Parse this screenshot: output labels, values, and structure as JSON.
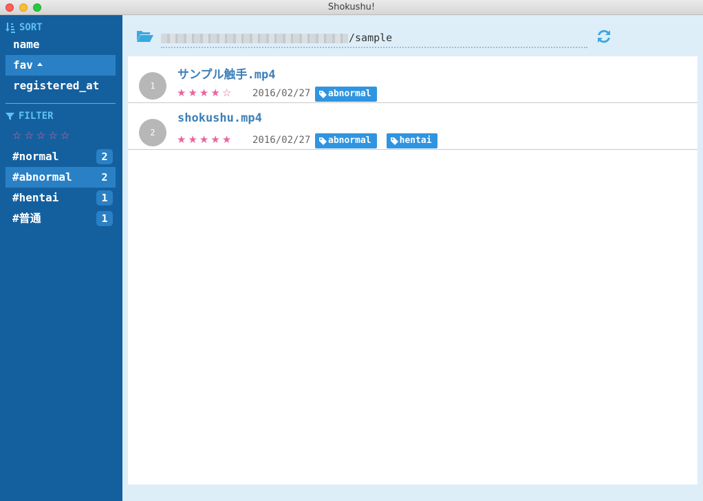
{
  "window": {
    "title": "Shokushu!"
  },
  "sidebar": {
    "sort": {
      "heading": "SORT",
      "icon": "sort-amount-icon",
      "items": [
        {
          "label": "name"
        },
        {
          "label": "fav",
          "active": true
        },
        {
          "label": "registered_at"
        }
      ]
    },
    "filter": {
      "heading": "FILTER",
      "icon": "filter-icon",
      "stars": [
        "☆",
        "☆",
        "☆",
        "☆",
        "☆"
      ],
      "tags": [
        {
          "label": "#normal",
          "count": "2"
        },
        {
          "label": "#abnormal",
          "count": "2",
          "active": true
        },
        {
          "label": "#hentai",
          "count": "1"
        },
        {
          "label": "#普通",
          "count": "1"
        }
      ]
    }
  },
  "pathbar": {
    "path_suffix": "/sample",
    "folder_icon": "folder-open-icon",
    "refresh_icon": "refresh-icon"
  },
  "files": [
    {
      "index": "1",
      "name": "サンプル触手.mp4",
      "stars": [
        "★",
        "★",
        "★",
        "★",
        "☆"
      ],
      "date": "2016/02/27",
      "tags": [
        "abnormal"
      ]
    },
    {
      "index": "2",
      "name": "shokushu.mp4",
      "stars": [
        "★",
        "★",
        "★",
        "★",
        "★"
      ],
      "date": "2016/02/27",
      "tags": [
        "abnormal",
        "hentai"
      ]
    }
  ],
  "colors": {
    "sidebar_bg": "#14609f",
    "sidebar_active": "#2a80c4",
    "accent": "#5ec2f1",
    "star": "#e8649c",
    "tag_bg": "#2f95e0",
    "file_name": "#3d7fb8"
  }
}
